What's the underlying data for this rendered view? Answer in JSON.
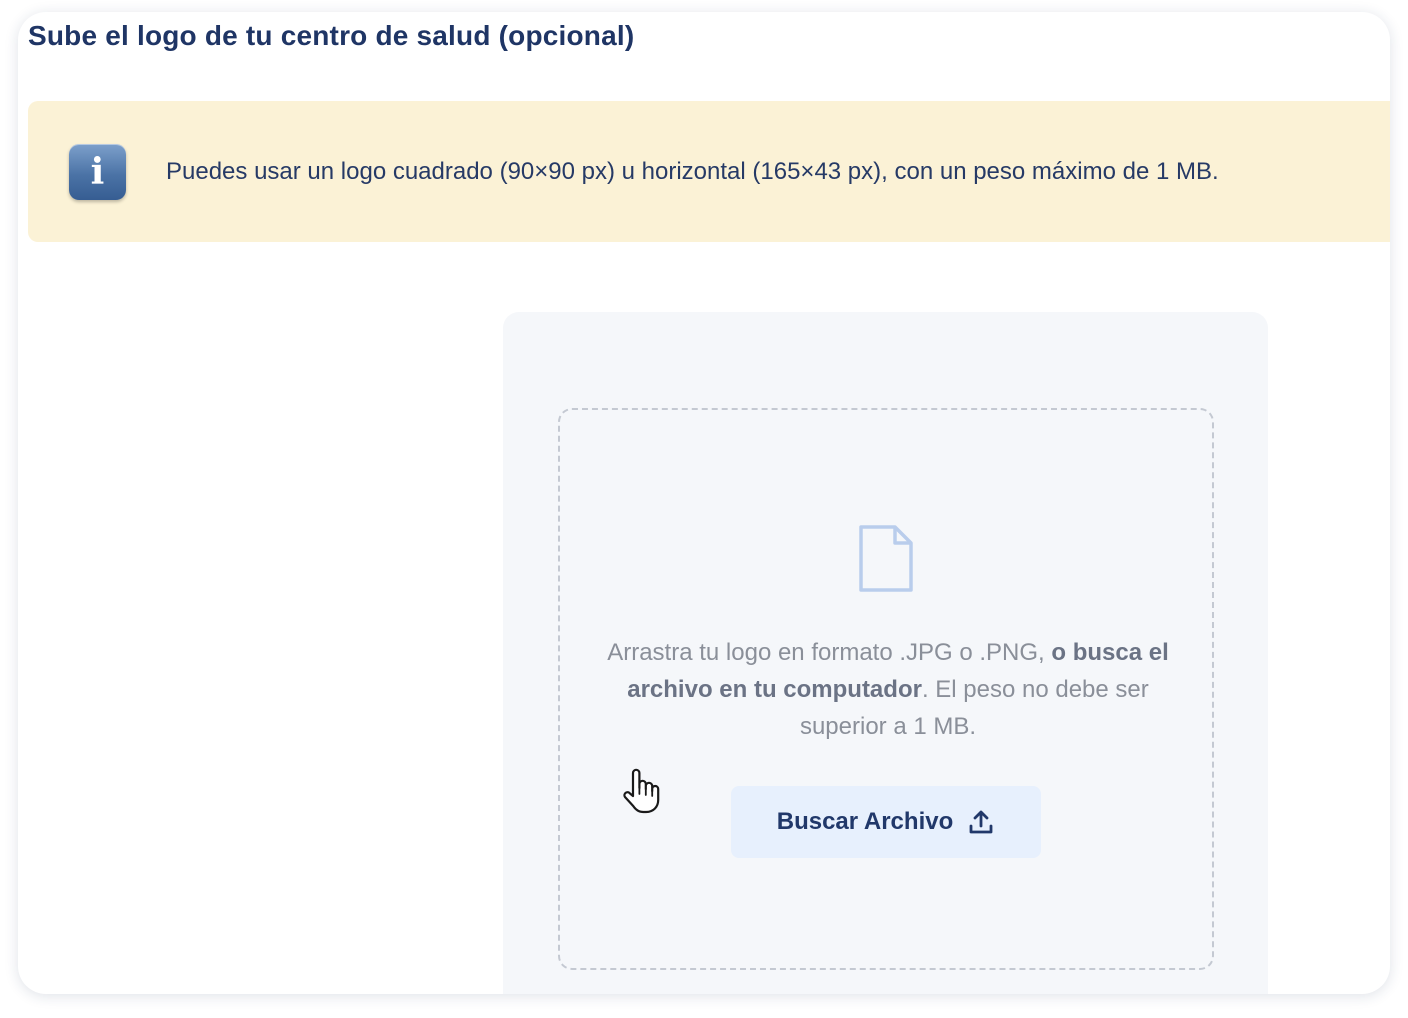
{
  "section": {
    "title": "Sube el logo de tu centro de salud (opcional)"
  },
  "notice": {
    "icon": "info-icon",
    "text": "Puedes usar un logo cuadrado (90×90 px) u horizontal (165×43 px), con un peso máximo de 1 MB."
  },
  "upload": {
    "icon": "file-icon",
    "text_part1": "Arrastra tu logo en formato .JPG o .PNG, ",
    "text_bold": "o busca el archivo en tu computador",
    "text_part2": ". El peso no debe ser superior a 1 MB.",
    "button_label": "Buscar Archivo",
    "button_icon": "upload-icon"
  },
  "pointer": {
    "icon": "hand-cursor-icon"
  },
  "colors": {
    "title": "#1f3565",
    "notice_bg": "#fbf2d6",
    "button_bg": "#e7f0fd",
    "button_text": "#21386a",
    "file_icon": "#b9cdec"
  }
}
